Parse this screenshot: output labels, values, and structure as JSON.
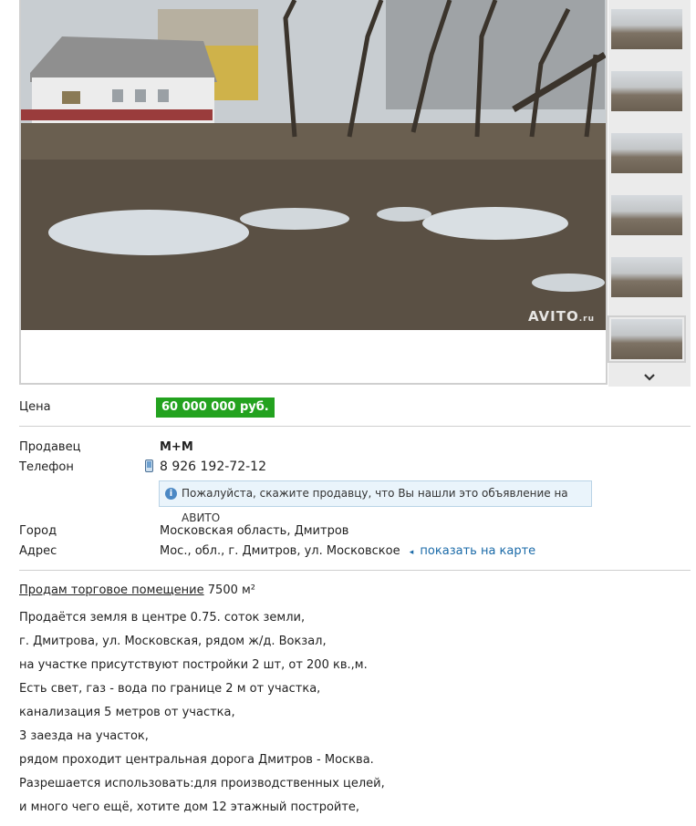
{
  "gallery": {
    "watermark": "AVITO",
    "watermark_sub": ".ru",
    "thumbnail_count": 6,
    "active_thumbnail_index": 6,
    "scroll_down_icon": "chevron-down-icon"
  },
  "details": {
    "price_label": "Цена",
    "price_value": "60 000 000 руб.",
    "price_color": "#23a21f",
    "seller_label": "Продавец",
    "seller_value": "М+М",
    "phone_label": "Телефон",
    "phone_value": "8 926 192-72-12",
    "phone_icon": "mobile-phone-icon",
    "notice_text": "Пожалуйста, скажите продавцу, что Вы нашли это объявление на АВИТО",
    "notice_icon": "info-icon",
    "city_label": "Город",
    "city_value": "Московская область, Дмитров",
    "address_label": "Адрес",
    "address_value": "Мос., обл., г. Дмитров, ул. Московское",
    "map_link": "показать на карте",
    "link_color": "#1a6aa8"
  },
  "description": {
    "title_link": "Продам торговое помещение",
    "title_area": "7500 м²",
    "lines": [
      "Продаётся земля в центре 0.75. соток земли,",
      "г. Дмитрова, ул. Московская, рядом ж/д. Вокзал,",
      "на участке присутствуют постройки 2 шт, от 200 кв.,м.",
      "Есть свет, газ - вода по границе 2 м от участка,",
      "канализация 5 метров от участка,",
      "3 заезда на участок,",
      "рядом проходит центральная дорога Дмитров - Москва.",
      "Разрешается использовать:для производственных целей,",
      "и много чего ещё, хотите дом 12 этажный постройте,"
    ]
  }
}
